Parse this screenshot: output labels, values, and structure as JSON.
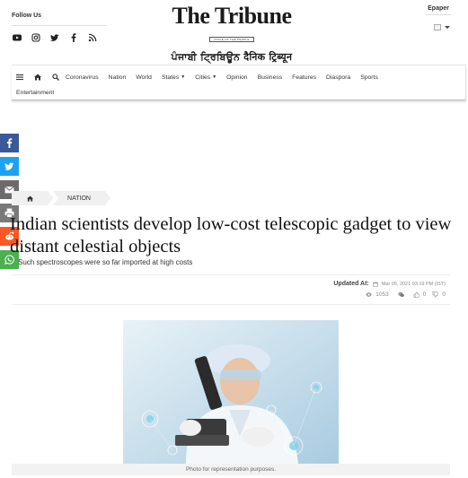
{
  "header": {
    "follow_label": "Follow Us",
    "social_icons": [
      "youtube-icon",
      "instagram-icon",
      "twitter-icon",
      "facebook-icon",
      "rss-icon"
    ],
    "logo_main": "The Tribune",
    "logo_tagline": "VOICE OF THE PEOPLE",
    "logo_sub": "ਪੰਜਾਬੀ ਟ੍ਰਿਬਿਊਨ  दैनिक ट्रिब्यून",
    "epaper_label": "Epaper"
  },
  "nav": {
    "items": [
      "Coronavirus",
      "Nation",
      "World",
      "States",
      "Cities",
      "Opinion",
      "Business",
      "Features",
      "Diaspora",
      "Sports"
    ],
    "dropdown_items": [
      "States",
      "Cities"
    ],
    "second_row_item": "Entertainment"
  },
  "share_rail": [
    {
      "icon": "facebook-icon",
      "color": "#3b5998"
    },
    {
      "icon": "twitter-icon",
      "color": "#1da1f2"
    },
    {
      "icon": "email-icon",
      "color": "#6b6b6b"
    },
    {
      "icon": "print-icon",
      "color": "#7a7a7a"
    },
    {
      "icon": "reddit-icon",
      "color": "#ff5722"
    },
    {
      "icon": "whatsapp-icon",
      "color": "#4caf50"
    }
  ],
  "breadcrumb": {
    "section": "NATION"
  },
  "article": {
    "headline": "Indian scientists develop low-cost telescopic gadget to view distant celestial objects",
    "subheadline": "Such spectroscopes were so far imported at high costs",
    "updated_label": "Updated At:",
    "updated_date": "Mar 05, 2021 03:19 PM (IST)",
    "views": "1053",
    "likes": "0",
    "dislikes": "0",
    "image_caption": "Photo for representation purposes."
  }
}
